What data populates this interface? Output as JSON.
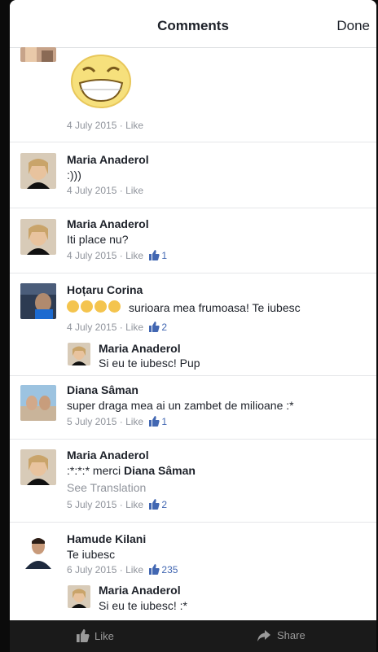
{
  "header": {
    "title": "Comments",
    "done_label": "Done"
  },
  "comments": [
    {
      "meta": {
        "date": "4 July 2015",
        "like": "Like"
      }
    },
    {
      "name": "Maria Anaderol",
      "text": ":)))",
      "meta": {
        "date": "4 July 2015",
        "like": "Like"
      }
    },
    {
      "name": "Maria Anaderol",
      "text": "Iti place nu?",
      "meta": {
        "date": "4 July 2015",
        "like": "Like",
        "likes": "1"
      }
    },
    {
      "name": "Hoțaru Corina",
      "text": "surioara mea frumoasa! Te iubesc",
      "meta": {
        "date": "4 July 2015",
        "like": "Like",
        "likes": "2"
      }
    },
    {
      "name": "Maria Anaderol",
      "text": "Si eu te iubesc! Pup"
    },
    {
      "name": "Diana Sâman",
      "text": "super draga mea ai un zambet de milioane :*",
      "meta": {
        "date": "5 July 2015",
        "like": "Like",
        "likes": "1"
      }
    },
    {
      "name": "Maria Anaderol",
      "text": ":*:*:* merci",
      "mention": "Diana Sâman",
      "see_translation": "See Translation",
      "meta": {
        "date": "5 July 2015",
        "like": "Like",
        "likes": "2"
      }
    },
    {
      "name": "Hamude Kilani",
      "text": "Te iubesc",
      "meta": {
        "date": "6 July 2015",
        "like": "Like",
        "likes": "235"
      }
    },
    {
      "name": "Maria Anaderol",
      "text": "Si eu te iubesc! :*"
    }
  ],
  "bottom_bar": {
    "like_label": "Like",
    "share_label": "Share"
  },
  "colors": {
    "link_blue": "#4267b2",
    "meta_gray": "#90949c"
  }
}
